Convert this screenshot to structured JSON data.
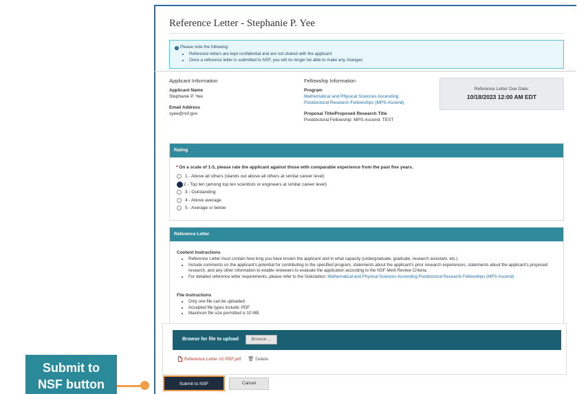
{
  "page": {
    "title": "Reference Letter - Stephanie P. Yee"
  },
  "notice": {
    "heading": "Please note the following:",
    "items": [
      "Reference letters are kept confidential and are not shared with the applicant",
      "Once a reference letter is submitted to NSF, you will no longer be able to make any changes"
    ]
  },
  "applicant": {
    "section_title": "Applicant Information",
    "name_label": "Applicant Name",
    "name": "Stephanie P. Yee",
    "email_label": "Email Address",
    "email": "syee@nsf.gov"
  },
  "fellowship": {
    "section_title": "Fellowship Information",
    "program_label": "Program",
    "program_line1": "Mathematical and Physical Sciences Ascending",
    "program_line2": "Postdoctoral Research Fellowships (MPS-Ascend)",
    "proposal_label": "Proposal Title/Proposed Research Title",
    "proposal_title": "Postdoctoral Fellowship: MPS-Ascend: TEST"
  },
  "due": {
    "label": "Reference Letter Due Date:",
    "value": "10/18/2023 12:00 AM EDT"
  },
  "rating": {
    "header": "Rating",
    "required_mark": "*",
    "question": "On a scale of 1-5, please rate the applicant against those with comparable experience from the past five years.",
    "options": [
      "1 - Above all others (stands out above all others at similar career level)",
      "2 - Top ten (among top ten scientists or engineers at similar career level)",
      "3 - Outstanding",
      "4 - Above average",
      "5 - Average or below"
    ],
    "selected": "2 - Top ten (among top ten scientists or engineers at similar career level)"
  },
  "letter": {
    "header": "Reference Letter",
    "content_title": "Content Instructions",
    "content_items": [
      "Reference Letter must contain how long you have known the applicant and in what capacity (undergraduate, graduate, research assistant, etc.)",
      "Include comments on the applicant's potential for contributing to the specified program, statements about the applicant's prior research experiences, statements about the applicant's proposed research, and any other information to enable reviewers to evaluate the application according to the NSF Merit Review Criteria.",
      "For detailed reference letter requirements, please refer to the Solicitation: "
    ],
    "solicitation_link": "Mathematical and Physical Sciences Ascending Postdoctoral Research Fellowships (MPS-Ascend)",
    "file_title": "File Instructions",
    "file_items": [
      "Only one file can be uploaded",
      "Accepted file types include: PDF",
      "Maximum file size permitted is 10 MB"
    ]
  },
  "upload": {
    "label": "Browse for file to upload",
    "browse": "Browse ...",
    "file_name": "Reference Letter #2 PDF.pdf",
    "delete": "Delete"
  },
  "actions": {
    "submit": "Submit to NSF",
    "cancel": "Cancel"
  },
  "callout": {
    "text_line1": "Submit to",
    "text_line2": "NSF button"
  },
  "colors": {
    "frame_border": "#2c6aa0",
    "panel_header": "#2f8a9c",
    "upload_bar": "#1a5f72",
    "submit_button": "#1d2d3d",
    "callout": "#2a8a9a",
    "highlight": "#f39c4a"
  }
}
